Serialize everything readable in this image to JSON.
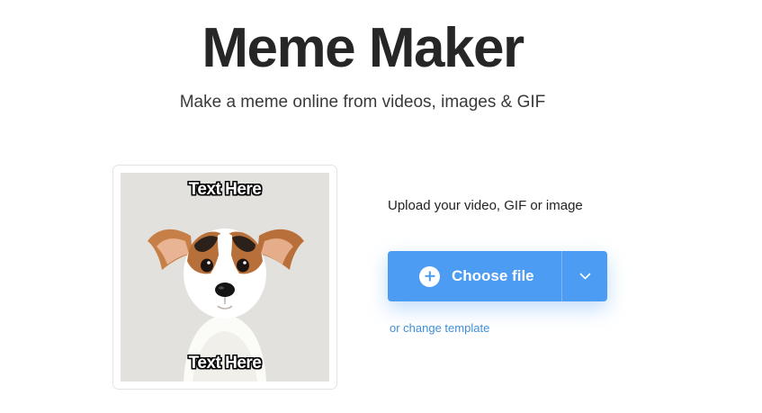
{
  "header": {
    "title": "Meme Maker",
    "subtitle": "Make a meme online from videos, images & GIF"
  },
  "preview": {
    "top_text": "Text Here",
    "bottom_text": "Text Here",
    "image_icon": "jack-russell-dog-photo"
  },
  "upload": {
    "label": "Upload your video, GIF or image",
    "choose_button": "Choose file",
    "choose_icon": "plus-circle-icon",
    "dropdown_icon": "chevron-down-icon",
    "change_template_link": "or change template"
  },
  "colors": {
    "accent": "#4b9cf2",
    "link": "#3f8fd8",
    "title": "#262626"
  }
}
